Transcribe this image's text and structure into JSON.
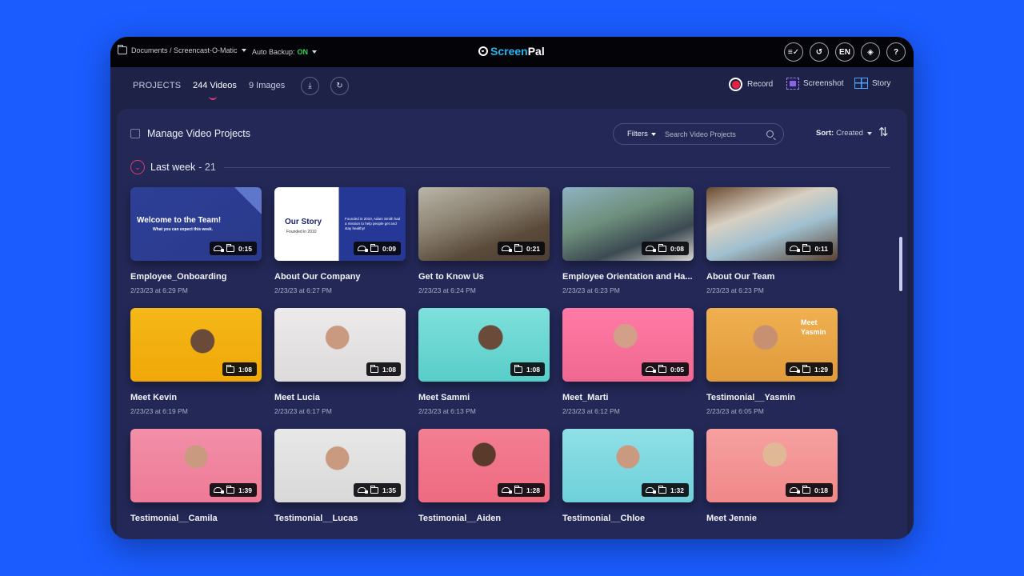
{
  "topbar": {
    "breadcrumb": "Documents / Screencast-O-Matic",
    "auto_backup_label": "Auto Backup:",
    "auto_backup_value": "ON",
    "logo": {
      "part1": "Screen",
      "part2": "Pal"
    },
    "icons": [
      {
        "name": "checklist-icon",
        "glyph": "≡✓"
      },
      {
        "name": "history-icon",
        "glyph": "↺"
      },
      {
        "name": "language-button",
        "glyph": "EN"
      },
      {
        "name": "layers-icon",
        "glyph": "◈"
      },
      {
        "name": "help-icon",
        "glyph": "?"
      }
    ]
  },
  "nav": {
    "projects": "PROJECTS",
    "videos": "244 Videos",
    "images": "9 Images",
    "import_glyph": "⤓",
    "refresh_glyph": "↻",
    "record": "Record",
    "screenshot": "Screenshot",
    "story": "Story"
  },
  "toolbar": {
    "manage_label": "Manage Video Projects",
    "filters_label": "Filters",
    "search_placeholder": "Search Video Projects",
    "sort_label": "Sort:",
    "sort_value": "Created",
    "sort_dir_glyph": "⇅"
  },
  "group": {
    "toggle_glyph": "⌄",
    "title": "Last week",
    "count": "- 21"
  },
  "colors": {
    "accent_pink": "#ec3c72",
    "backup_on": "#2fd35a",
    "logo_blue": "#21b5f0",
    "record_red": "#e82044"
  },
  "videos": [
    {
      "title": "Employee_Onboarding",
      "date": "2/23/23 at 6:29 PM",
      "duration": "0:15",
      "cloud": true,
      "thumb_heading": "Welcome to the Team!",
      "thumb_sub": "What you can expect this week."
    },
    {
      "title": "About Our Company",
      "date": "2/23/23 at 6:27 PM",
      "duration": "0:09",
      "cloud": true,
      "thumb_heading": "Our Story",
      "thumb_sub": "Founded in 2010",
      "thumb_body": "Founded in 2010, Adam Smith had a mission to help people get and stay healthy!"
    },
    {
      "title": "Get to Know Us",
      "date": "2/23/23 at 6:24 PM",
      "duration": "0:21",
      "cloud": true
    },
    {
      "title": "Employee Orientation and Ha...",
      "date": "2/23/23 at 6:23 PM",
      "duration": "0:08",
      "cloud": true
    },
    {
      "title": "About Our Team",
      "date": "2/23/23 at 6:23 PM",
      "duration": "0:11",
      "cloud": true
    },
    {
      "title": "Meet Kevin",
      "date": "2/23/23 at 6:19 PM",
      "duration": "1:08",
      "cloud": false
    },
    {
      "title": "Meet Lucia",
      "date": "2/23/23 at 6:17 PM",
      "duration": "1:08",
      "cloud": false
    },
    {
      "title": "Meet Sammi",
      "date": "2/23/23 at 6:13 PM",
      "duration": "1:08",
      "cloud": false
    },
    {
      "title": "Meet_Marti",
      "date": "2/23/23 at 6:12 PM",
      "duration": "0:05",
      "cloud": true
    },
    {
      "title": "Testimonial__Yasmin",
      "date": "2/23/23 at 6:05 PM",
      "duration": "1:29",
      "cloud": true,
      "thumb_heading": "Meet Yasmin"
    },
    {
      "title": "Testimonial__Camila",
      "date": "",
      "duration": "1:39",
      "cloud": true
    },
    {
      "title": "Testimonial__Lucas",
      "date": "",
      "duration": "1:35",
      "cloud": true
    },
    {
      "title": "Testimonial__Aiden",
      "date": "",
      "duration": "1:28",
      "cloud": true
    },
    {
      "title": "Testimonial__Chloe",
      "date": "",
      "duration": "1:32",
      "cloud": true
    },
    {
      "title": "Meet Jennie",
      "date": "",
      "duration": "0:18",
      "cloud": true
    }
  ]
}
